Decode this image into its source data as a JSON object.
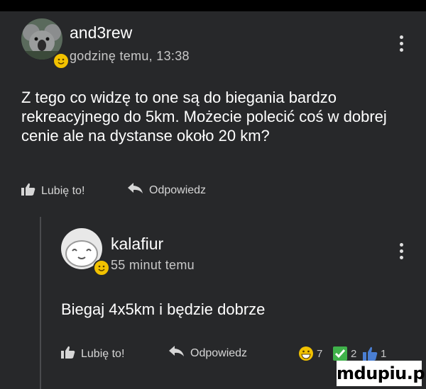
{
  "post": {
    "username": "and3rew",
    "time": "godzinę temu, 13:38",
    "text": "Z tego co widzę to one są do biegania bardzo rekreacyjnego do 5km. Możecie polecić coś w dobrej cenie ale na dystanse około 20 km?",
    "like_label": "Lubię to!",
    "reply_label": "Odpowiedz",
    "avatar_icon": "koala-avatar",
    "badge_icon": "emoji-badge-icon"
  },
  "reply": {
    "username": "kalafiur",
    "time": "55 minut temu",
    "text": "Biegaj 4x5km i będzie dobrze",
    "like_label": "Lubię to!",
    "reply_label": "Odpowiedz",
    "avatar_icon": "cartoon-face-avatar",
    "reactions": [
      {
        "icon": "grin-emoji-icon",
        "count": "7"
      },
      {
        "icon": "checkmark-icon",
        "count": "2"
      },
      {
        "icon": "thumbs-up-icon",
        "count": "1"
      }
    ]
  },
  "watermark": "mdupiu.pl",
  "colors": {
    "background": "#27282a",
    "badge": "#f2c200",
    "check": "#3fb24a"
  }
}
